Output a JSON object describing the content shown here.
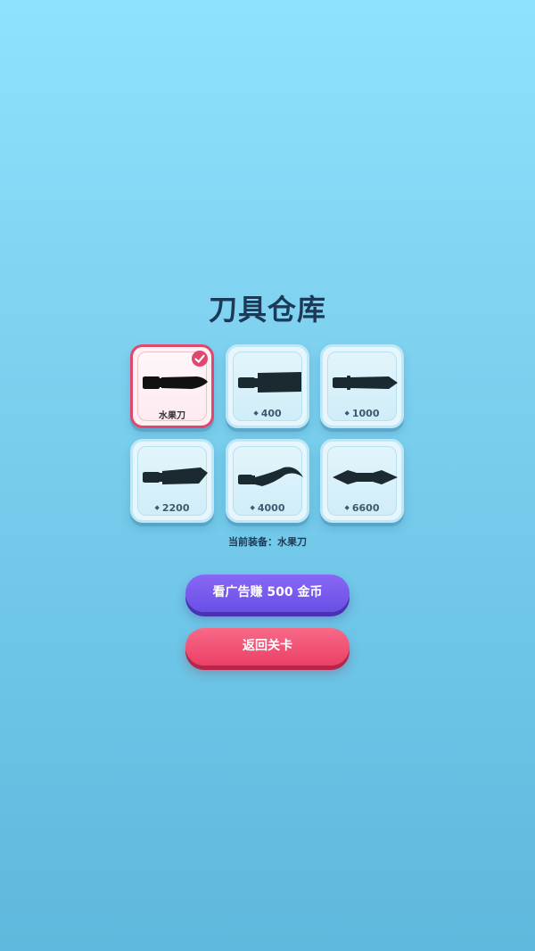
{
  "title": "刀具仓库",
  "knives": [
    {
      "id": "fruit-knife",
      "label": "水果刀",
      "selected": true
    },
    {
      "id": "cleaver",
      "price": "400",
      "selected": false
    },
    {
      "id": "dagger",
      "price": "1000",
      "selected": false
    },
    {
      "id": "machete",
      "price": "2200",
      "selected": false
    },
    {
      "id": "karambit",
      "price": "4000",
      "selected": false
    },
    {
      "id": "double-blade",
      "price": "6600",
      "selected": false
    }
  ],
  "currency_icon": "diamond-icon",
  "equipped_text": "当前装备：水果刀",
  "buttons": {
    "watch_ad": "看广告赚 500 金币",
    "back": "返回关卡"
  },
  "colors": {
    "selected_border": "#e0476e",
    "ad_button": "#7a5cf0",
    "back_button": "#f0506f",
    "title": "#1b3a57",
    "knife_silhouette": "#1a2a30"
  }
}
